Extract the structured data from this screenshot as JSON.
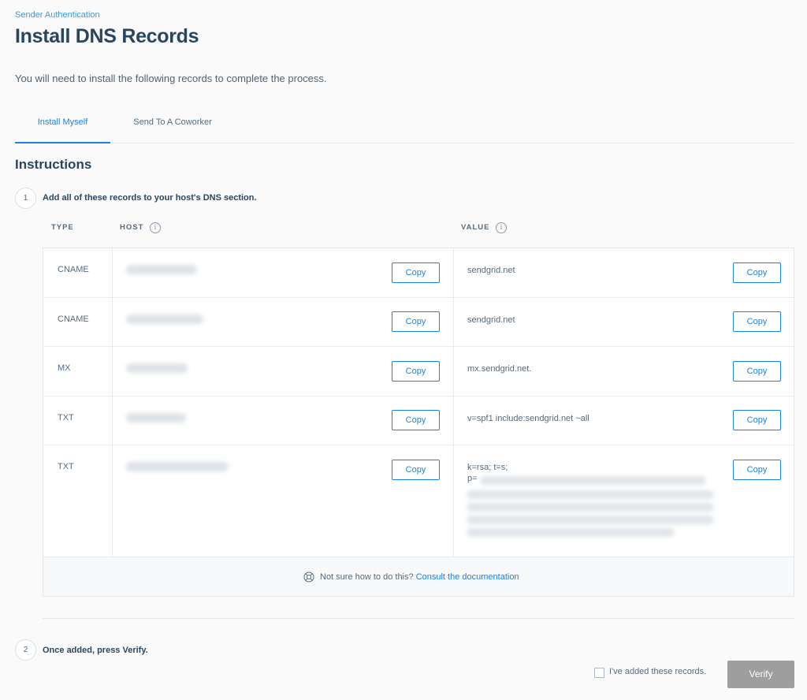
{
  "header": {
    "breadcrumb": "Sender Authentication",
    "title": "Install DNS Records",
    "subtitle": "You will need to install the following records to complete the process."
  },
  "tabs": [
    {
      "label": "Install Myself",
      "active": true
    },
    {
      "label": "Send To A Coworker",
      "active": false
    }
  ],
  "instructions": {
    "title": "Instructions",
    "step1": {
      "number": "1",
      "text": "Add all of these records to your host's DNS section."
    },
    "step2": {
      "number": "2",
      "text": "Once added, press Verify."
    }
  },
  "table": {
    "columns": {
      "type": "TYPE",
      "host": "HOST",
      "value": "VALUE"
    },
    "copy_label": "Copy",
    "rows": [
      {
        "type": "CNAME",
        "value": "sendgrid.net"
      },
      {
        "type": "CNAME",
        "value": "sendgrid.net"
      },
      {
        "type": "MX",
        "value": "mx.sendgrid.net."
      },
      {
        "type": "TXT",
        "value": "v=spf1 include:sendgrid.net ~all"
      },
      {
        "type": "TXT",
        "value_line1": "k=rsa; t=s;",
        "value_line2": "p="
      }
    ],
    "footer": {
      "prompt": "Not sure how to do this?",
      "link": "Consult the documentation"
    }
  },
  "confirm": {
    "checkbox_label": "I've added these records.",
    "checked": false,
    "verify_label": "Verify"
  },
  "colors": {
    "accent": "#1a82e2",
    "title": "#294661",
    "verify_disabled": "#9e9e9e"
  }
}
